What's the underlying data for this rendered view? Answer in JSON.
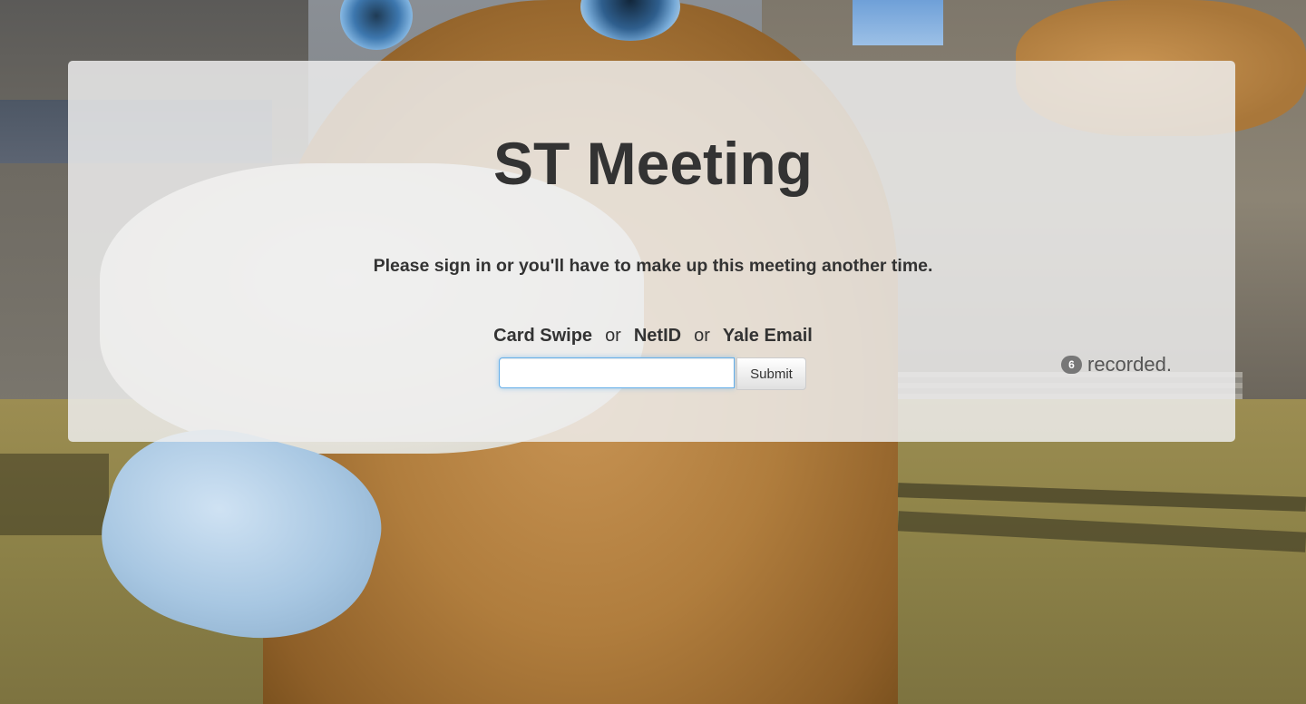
{
  "page": {
    "title": "ST Meeting",
    "subtitle": "Please sign in or you'll have to make up this meeting another time."
  },
  "signin": {
    "methods": {
      "card_swipe": "Card Swipe",
      "or_1": "or",
      "netid": "NetID",
      "or_2": "or",
      "yale_email": "Yale Email"
    },
    "input_value": "",
    "submit_label": "Submit"
  },
  "status": {
    "recorded_count": "6",
    "recorded_label": "recorded."
  },
  "colors": {
    "panel_background": "#EEEEEE",
    "text": "#333333",
    "input_focus_border": "#66AFE9",
    "badge": "#777777"
  }
}
